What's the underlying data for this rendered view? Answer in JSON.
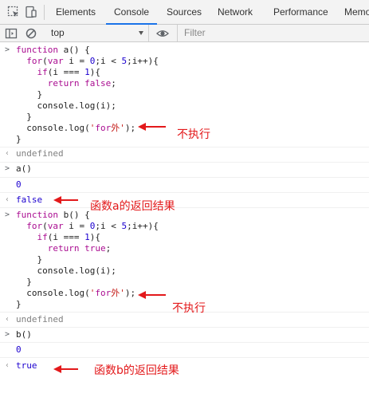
{
  "tabs": [
    {
      "label": "Elements",
      "active": false
    },
    {
      "label": "Console",
      "active": true
    },
    {
      "label": "Sources",
      "active": false
    },
    {
      "label": "Network",
      "active": false
    },
    {
      "label": "Performance",
      "active": false
    },
    {
      "label": "Memo",
      "active": false
    }
  ],
  "toolbar": {
    "context": "top",
    "filter_placeholder": "Filter"
  },
  "console": {
    "block_a": [
      "function a() {",
      "  for(var i = 0;i < 5;i++){",
      "    if(i === 1){",
      "      return false;",
      "    }",
      "    console.log(i);",
      "  }",
      "  console.log('for外');",
      "}"
    ],
    "undefined_1": "undefined",
    "call_a": "a()",
    "out_a_0": "0",
    "result_a": "false",
    "block_b": [
      "function b() {",
      "  for(var i = 0;i < 5;i++){",
      "    if(i === 1){",
      "      return true;",
      "    }",
      "    console.log(i);",
      "  }",
      "  console.log('for外');",
      "}"
    ],
    "undefined_2": "undefined",
    "call_b": "b()",
    "out_b_0": "0",
    "result_b": "true"
  },
  "annotations": {
    "not_executed_1": "不执行",
    "return_a": "函数a的返回结果",
    "not_executed_2": "不执行",
    "return_b": "函数b的返回结果",
    "color": "#e3191b"
  }
}
